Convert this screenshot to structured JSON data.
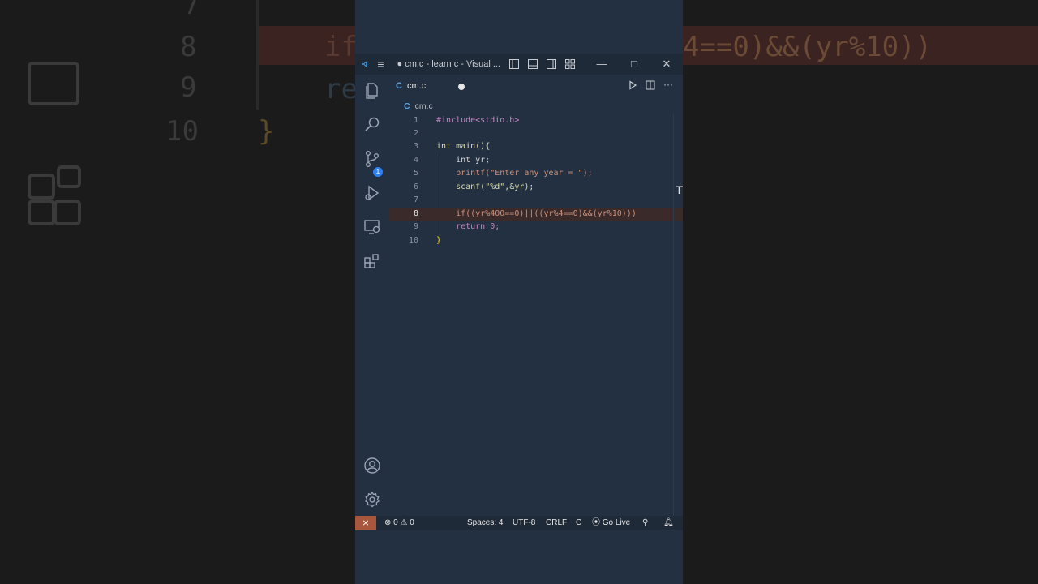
{
  "window": {
    "title": "● cm.c - learn c - Visual ...",
    "controls": {
      "minimize": "—",
      "maximize": "□",
      "close": "✕"
    }
  },
  "activity_bar": {
    "explorer_badge": "1",
    "items": [
      "files-icon",
      "search-icon",
      "source-control-icon",
      "run-debug-icon",
      "remote-explorer-icon",
      "extensions-icon"
    ],
    "bottom_items": [
      "account-icon",
      "settings-gear-icon"
    ]
  },
  "tabs": [
    {
      "icon": "C",
      "label": "cm.c",
      "modified": true
    }
  ],
  "breadcrumb": {
    "icon": "C",
    "file": "cm.c"
  },
  "editor": {
    "lines": [
      {
        "n": "1",
        "text": "#include<stdio.h>"
      },
      {
        "n": "2",
        "text": ""
      },
      {
        "n": "3",
        "text": "int main(){"
      },
      {
        "n": "4",
        "text": "    int yr;"
      },
      {
        "n": "5",
        "text": "    printf(\"Enter any year = \");"
      },
      {
        "n": "6",
        "text": "    scanf(\"%d\",&yr);"
      },
      {
        "n": "7",
        "text": ""
      },
      {
        "n": "8",
        "text": "    if((yr%400==0)||((yr%4==0)&&(yr%10)))"
      },
      {
        "n": "9",
        "text": "    return 0;"
      },
      {
        "n": "10",
        "text": "}"
      }
    ],
    "scroll_marker": "T"
  },
  "status_bar": {
    "remote": "⨯",
    "errors": "0",
    "warnings": "0",
    "spaces": "Spaces: 4",
    "encoding": "UTF-8",
    "eol": "CRLF",
    "language": "C",
    "go_live": "Go Live"
  },
  "backdrop": {
    "numbers": [
      "7",
      "8",
      "9",
      "10"
    ],
    "code_fragment": "4==0)&&(yr%10))",
    "left_fragments": [
      "if",
      "re",
      "}"
    ]
  },
  "colors": {
    "editor_bg": "#233042",
    "keyword": "#569cd6",
    "function": "#dcdcaa",
    "string": "#ce9178",
    "number": "#b5cea8",
    "accent_badge": "#2f80ed",
    "remote_indicator": "#a8563c"
  }
}
